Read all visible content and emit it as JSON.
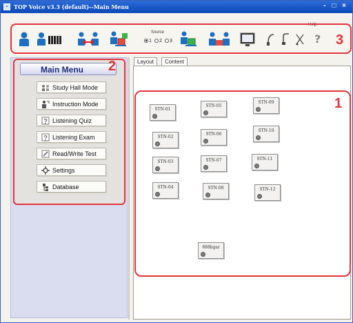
{
  "window": {
    "title": "TOP Voice v3.3 (default)--Main Menu",
    "controls": "- □ ×"
  },
  "toolbar": {
    "source_label": "Source",
    "source_options": [
      "1",
      "2",
      "3"
    ],
    "source_selected": "1",
    "help_label": "Help",
    "callout": "3"
  },
  "main_menu": {
    "title": "Main Menu",
    "callout": "2",
    "items": [
      {
        "label": "Study Hall Mode"
      },
      {
        "label": "Instruction Mode"
      },
      {
        "label": "Listening Quiz"
      },
      {
        "label": "Listening Exam"
      },
      {
        "label": "Read/Write Test"
      },
      {
        "label": "Settings"
      },
      {
        "label": "Database"
      }
    ]
  },
  "content": {
    "tabs": [
      {
        "label": "Layout"
      },
      {
        "label": "Content"
      }
    ],
    "callout": "1",
    "stations": [
      {
        "label": "STN-01"
      },
      {
        "label": "STN-05"
      },
      {
        "label": "STN-09"
      },
      {
        "label": "STN-02"
      },
      {
        "label": "STN-06"
      },
      {
        "label": "STN-10"
      },
      {
        "label": "STN-03"
      },
      {
        "label": "STN-07"
      },
      {
        "label": "STN-11"
      },
      {
        "label": "STN-04"
      },
      {
        "label": "STN-08"
      },
      {
        "label": "STN-12"
      },
      {
        "label": "888bgar"
      }
    ]
  },
  "colors": {
    "titlebar": "#0b47b8",
    "highlight": "#e2323a",
    "sidebar": "#dadcf0",
    "menu_title": "#1c2a78"
  }
}
